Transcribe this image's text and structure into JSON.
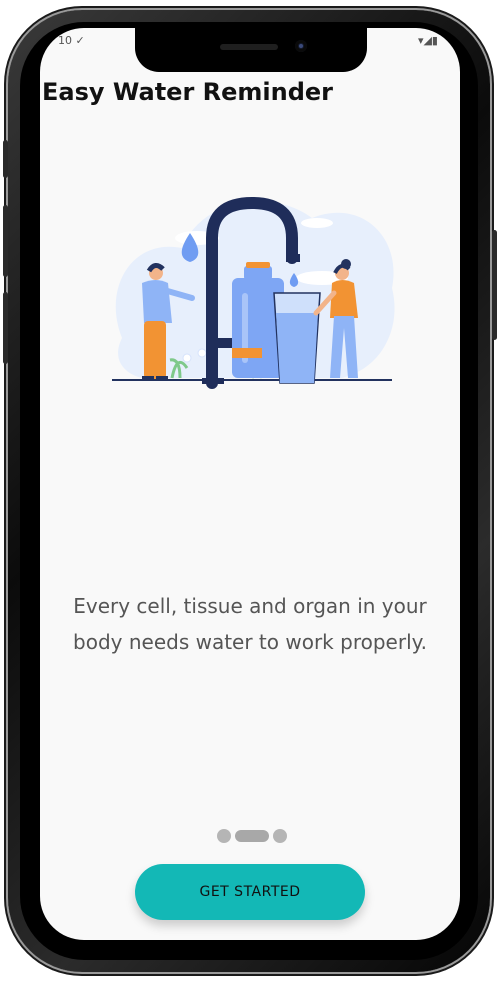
{
  "app": {
    "title": "Easy Water Reminder"
  },
  "status_bar": {
    "left": "10 ✓",
    "right": "▾◢▮"
  },
  "onboarding": {
    "message": "Every cell, tissue and organ in your body needs water to work properly.",
    "pages_total": 3,
    "current_page": 2,
    "get_started_label": "GET STARTED"
  },
  "colors": {
    "accent": "#13b8b6",
    "background": "#f9f9f9",
    "water_blue": "#6f9cf2",
    "faucet_navy": "#1f2d5a",
    "orange": "#f29333"
  },
  "icons": [
    "water-drop-icon",
    "faucet-icon"
  ]
}
